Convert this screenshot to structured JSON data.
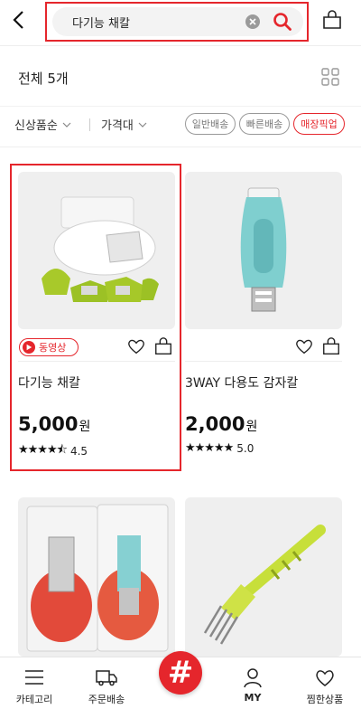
{
  "header": {
    "search_value": "다기능 채칼"
  },
  "results": {
    "count_text": "전체 5개"
  },
  "filters": {
    "new_label": "신상품순",
    "price_label": "가격대",
    "pills": [
      "일반배송",
      "빠른배송",
      "매장픽업"
    ]
  },
  "products": [
    {
      "title": "다기능 채칼",
      "price": "5,000",
      "currency": "원",
      "stars": "★★★★⯪",
      "rating": "4.5",
      "badge": "동영상"
    },
    {
      "title": "3WAY 다용도 감자칼",
      "price": "2,000",
      "currency": "원",
      "stars": "★★★★★",
      "rating": "5.0"
    },
    {
      "title": "",
      "price": "",
      "currency": "",
      "stars": "",
      "rating": ""
    },
    {
      "title": "",
      "price": "",
      "currency": "",
      "stars": "",
      "rating": ""
    }
  ],
  "bottom_nav": {
    "category": "카테고리",
    "orders": "주문배송",
    "hash": "#",
    "my": "MY",
    "wishlist": "찜한상품"
  },
  "colors": {
    "accent": "#e5262c",
    "card_bg": "#efefef"
  }
}
